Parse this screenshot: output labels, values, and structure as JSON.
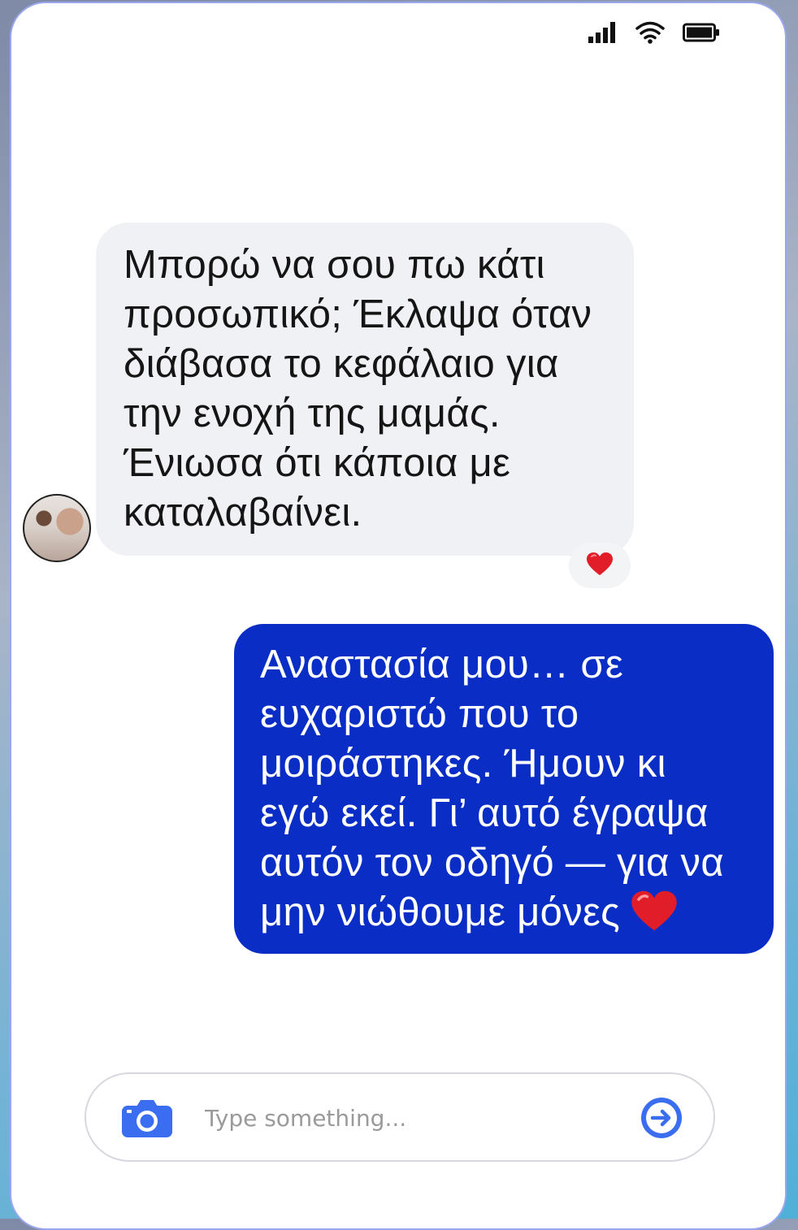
{
  "status_bar": {
    "signal_icon": "cellular-signal-icon",
    "wifi_icon": "wifi-icon",
    "battery_icon": "battery-icon"
  },
  "conversation": {
    "incoming": {
      "text": "Μπορώ να σου πω κάτι\nπροσωπικό; Έκλαψα όταν\nδιάβασα το κεφάλαιο για\nτην ενοχή της μαμάς.\nΈνιωσα ότι κάποια με\nκαταλαβαίνει.",
      "reaction_icon": "red-heart-icon"
    },
    "outgoing": {
      "text": "Αναστασία μου… σε\nευχαριστώ που το\nμοιράστηκες. Ήμουν κι\nεγώ εκεί. Γι’ αυτό έγραψα\nαυτόν τον οδηγό — για να\nμην νιώθουμε μόνες",
      "trailing_icon": "red-heart-icon"
    }
  },
  "composer": {
    "placeholder": "Type something...",
    "value": "",
    "camera_icon": "camera-icon",
    "send_icon": "arrow-right-circle-icon"
  },
  "colors": {
    "outgoing_bubble": "#0a2ec5",
    "incoming_bubble": "#f0f1f5",
    "accent_icon": "#3a6df0",
    "heart": "#e11d2a"
  }
}
